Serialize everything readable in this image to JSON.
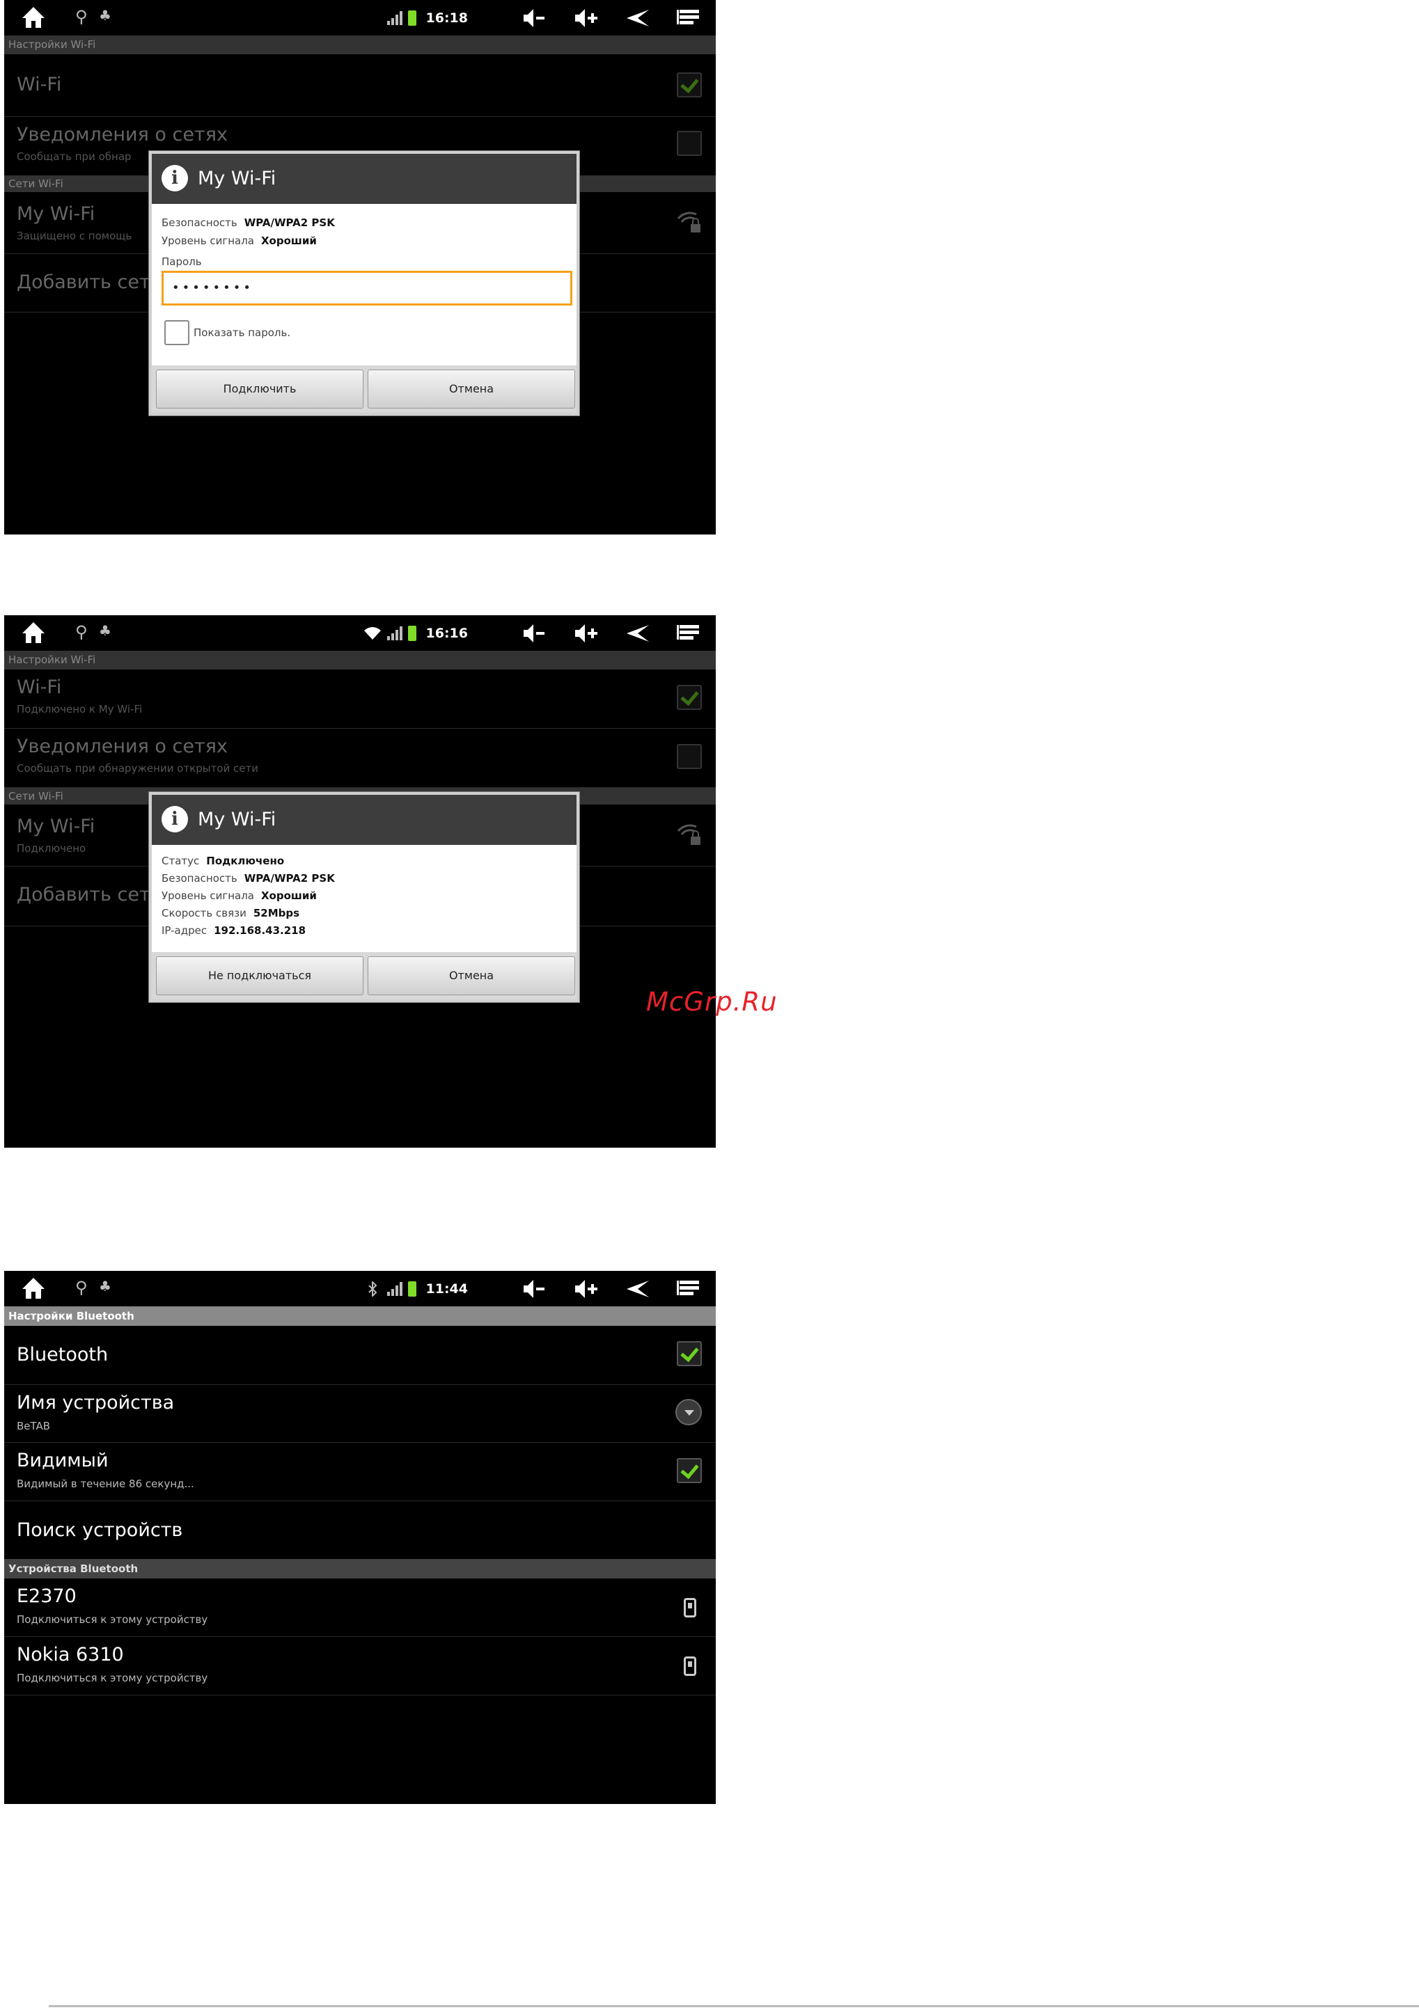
{
  "statusbar_shot1": {
    "time": "16:18"
  },
  "statusbar_shot2": {
    "time": "16:16"
  },
  "statusbar_shot3": {
    "time": "11:44"
  },
  "wifi_settings_1": {
    "header": "Настройки Wi-Fi",
    "wifi_title": "Wi-Fi",
    "notify_title": "Уведомления о сетях",
    "notify_sub": "Сообщать при обнар",
    "networks_header": "Сети Wi-Fi",
    "network_title": "My Wi-Fi",
    "network_sub": "Защищено с помощь",
    "add_network": "Добавить сеть"
  },
  "dialog1": {
    "title": "My Wi-Fi",
    "security_label": "Безопасность",
    "security_value": "WPA/WPA2 PSK",
    "signal_label": "Уровень сигнала",
    "signal_value": "Хороший",
    "password_label": "Пароль",
    "password_value": "••••••••",
    "show_password": "Показать пароль.",
    "connect": "Подключить",
    "cancel": "Отмена"
  },
  "wifi_settings_2": {
    "header": "Настройки Wi-Fi",
    "wifi_title": "Wi-Fi",
    "wifi_sub": "Подключено к My Wi-Fi",
    "notify_title": "Уведомления о сетях",
    "notify_sub": "Сообщать при обнаружении открытой сети",
    "networks_header": "Сети Wi-Fi",
    "network_title": "My Wi-Fi",
    "network_sub": "Подключено",
    "add_network": "Добавить сеть"
  },
  "dialog2": {
    "title": "My Wi-Fi",
    "status_label": "Статус",
    "status_value": "Подключено",
    "security_label": "Безопасность",
    "security_value": "WPA/WPA2 PSK",
    "signal_label": "Уровень сигнала",
    "signal_value": "Хороший",
    "speed_label": "Скорость связи",
    "speed_value": "52Mbps",
    "ip_label": "IP-адрес",
    "ip_value": "192.168.43.218",
    "disconnect": "Не подключаться",
    "cancel": "Отмена"
  },
  "bluetooth_settings": {
    "header": "Настройки Bluetooth",
    "bt_title": "Bluetooth",
    "name_title": "Имя устройства",
    "name_sub": "BeTAB",
    "visible_title": "Видимый",
    "visible_sub": "Видимый в течение 86 секунд...",
    "search": "Поиск устройств",
    "devices_header": "Устройства Bluetooth",
    "devices": [
      {
        "name": "E2370",
        "sub": "Подключиться к этому устройству"
      },
      {
        "name": "Nokia 6310",
        "sub": "Подключиться к этому устройству"
      }
    ]
  },
  "watermark": "McGrp.Ru",
  "colors": {
    "accent_green": "#6dd21e",
    "focus_orange": "#f6a01a",
    "watermark_red": "#e8222a"
  }
}
